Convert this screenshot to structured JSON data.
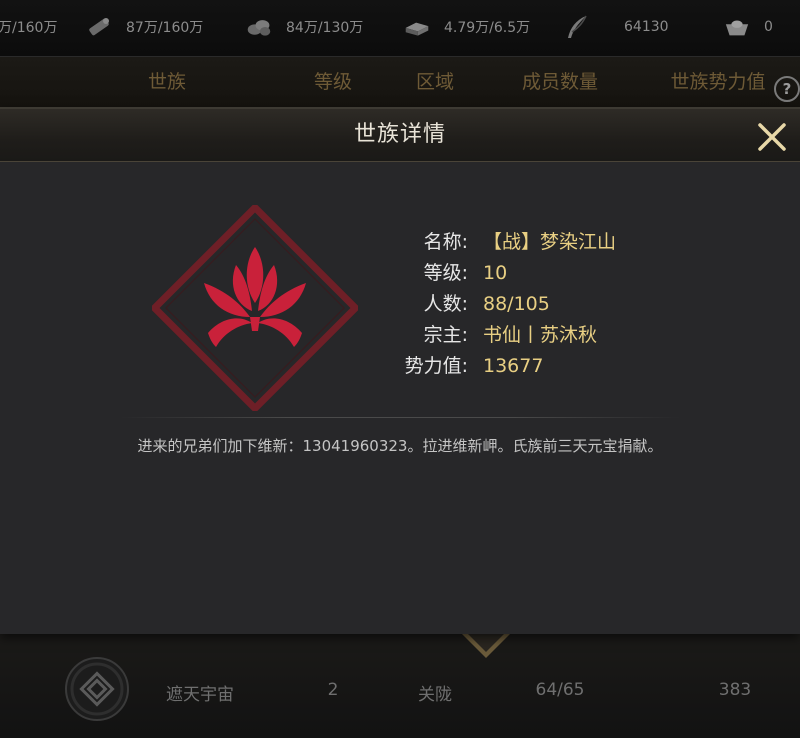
{
  "resources": [
    {
      "icon": "scroll-icon",
      "text": "万/160万"
    },
    {
      "icon": "wood-icon",
      "text": "87万/160万"
    },
    {
      "icon": "stone-icon",
      "text": "84万/130万"
    },
    {
      "icon": "iron-icon",
      "text": "4.79万/6.5万"
    },
    {
      "icon": "feather-icon",
      "text": "64130"
    },
    {
      "icon": "ingot-icon",
      "text": "0"
    }
  ],
  "table_header": {
    "name": "世族",
    "level": "等级",
    "region": "区域",
    "members": "成员数量",
    "power": "世族势力值",
    "help": "?"
  },
  "modal": {
    "title": "世族详情",
    "close_symbol": "✕",
    "fields": [
      {
        "label": "名称:",
        "value": "【战】梦染江山"
      },
      {
        "label": "等级:",
        "value": "10"
      },
      {
        "label": "人数:",
        "value": "88/105"
      },
      {
        "label": "宗主:",
        "value": "书仙丨苏沐秋"
      },
      {
        "label": "势力值:",
        "value": "13677"
      }
    ],
    "announcement": "进来的兄弟们加下维新：13041960323。拉进维新岬。氏族前三天元宝捐献。",
    "colors": {
      "emblem": "#c9213a",
      "frame": "#6e1f27",
      "label": "#e6e6e6",
      "value": "#e8cf83"
    }
  },
  "bottom_row": {
    "name": "遮天宇宙",
    "level": "2",
    "region": "关陇",
    "members": "64/65",
    "power": "383"
  }
}
